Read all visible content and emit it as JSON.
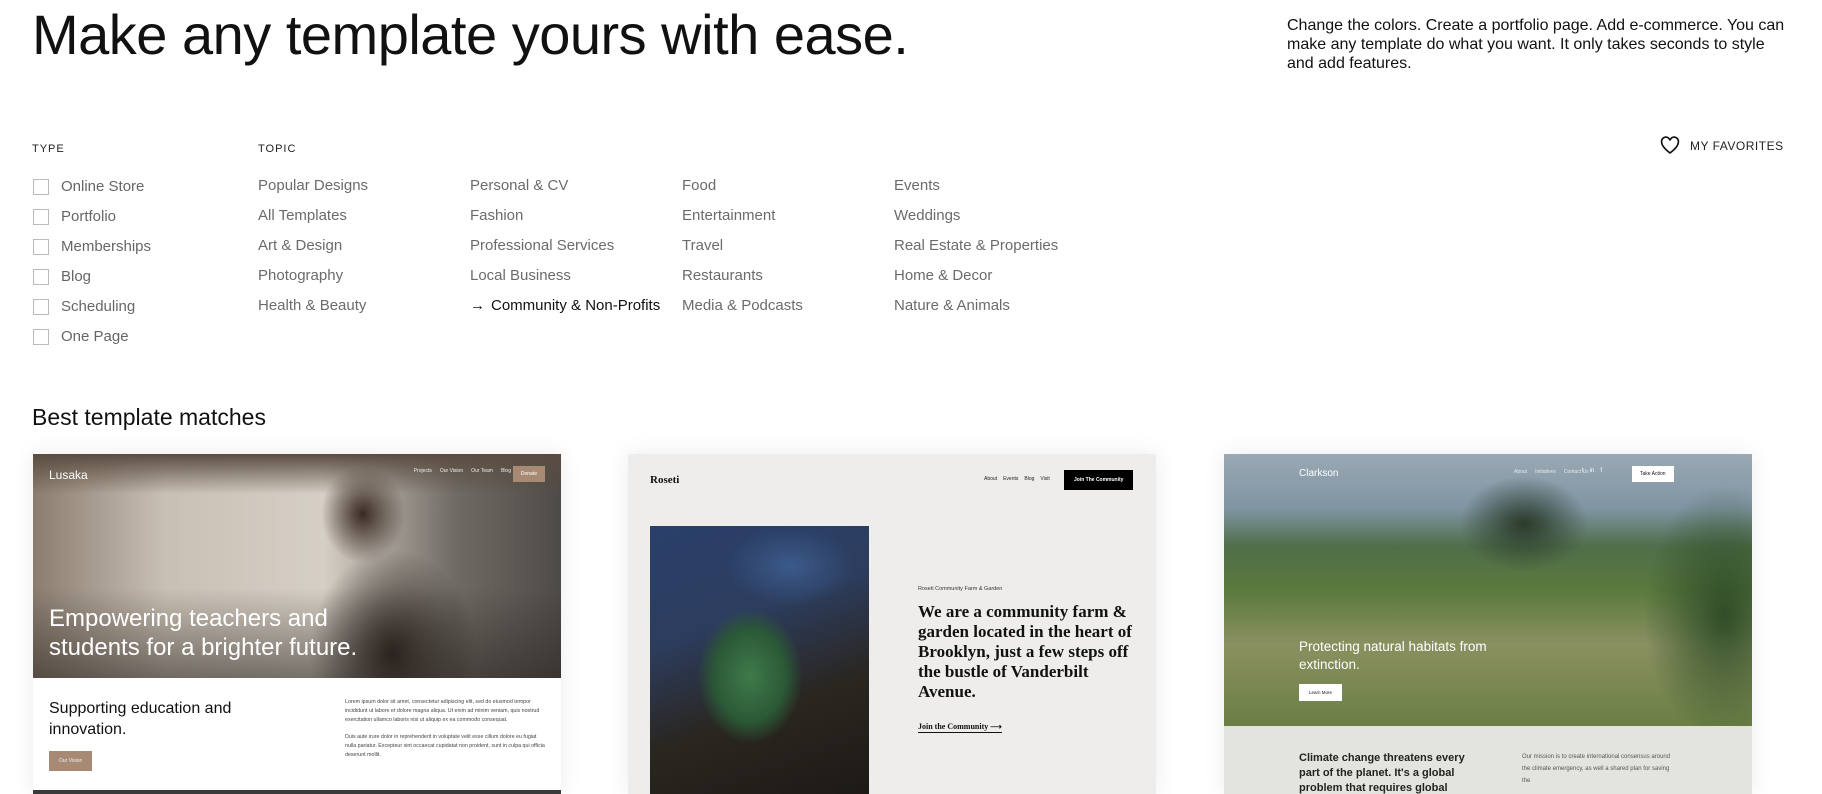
{
  "header": {
    "title": "Make any template yours with ease.",
    "intro": "Change the colors. Create a portfolio page. Add e-commerce. You can make any template do what you want. It only takes seconds to style and add features.",
    "favorites_label": "MY FAVORITES",
    "favorites_icon": "heart-icon"
  },
  "filters": {
    "type_label": "TYPE",
    "types": [
      "Online Store",
      "Portfolio",
      "Memberships",
      "Blog",
      "Scheduling",
      "One Page"
    ],
    "topic_label": "TOPIC",
    "topic_columns": [
      [
        "Popular Designs",
        "All Templates",
        "Art & Design",
        "Photography",
        "Health & Beauty"
      ],
      [
        "Personal & CV",
        "Fashion",
        "Professional Services",
        "Local Business",
        "Community & Non-Profits"
      ],
      [
        "Food",
        "Entertainment",
        "Travel",
        "Restaurants",
        "Media & Podcasts"
      ],
      [
        "Events",
        "Weddings",
        "Real Estate & Properties",
        "Home & Decor",
        "Nature & Animals"
      ]
    ],
    "active_topic": "Community & Non-Profits",
    "active_marker": "→"
  },
  "results": {
    "title": "Best template matches",
    "templates": [
      {
        "name": "Lusaka",
        "nav": [
          "Projects",
          "Our Vision",
          "Our Team",
          "Blog"
        ],
        "cta": "Donate",
        "hero": "Empowering teachers and students for a brighter future.",
        "subhead": "Supporting education and innovation.",
        "button": "Our Vision",
        "body": [
          "Lorem ipsum dolor sit amet, consectetur adipiscing elit, sed do eiusmod tempor incididunt ut labore et dolore magna aliqua. Ut enim ad minim veniam, quis nostrud exercitation ullamco laboris nisi ut aliquip ex ea commodo consequat.",
          "Duis aute irure dolor in reprehenderit in voluptate velit esse cillum dolore eu fugiat nulla pariatur. Excepteur sint occaecat cupidatat non proident, sunt in culpa qui officia deserunt mollit."
        ],
        "accent": "#a88a74"
      },
      {
        "name": "Roseti",
        "nav": [
          "About",
          "Events",
          "Blog",
          "Visit"
        ],
        "cta": "Join The Community",
        "caption": "Roseti Community Farm & Garden",
        "hero": "We are a community farm & garden located in the heart of Brooklyn, just a few steps off the bustle of Vanderbilt Avenue.",
        "link": "Join the Community ⟶"
      },
      {
        "name": "Clarkson",
        "nav": [
          "About",
          "Initiatives",
          "Contact Us"
        ],
        "social": [
          "twitter-icon",
          "linkedin-icon",
          "facebook-icon"
        ],
        "cta": "Take Action",
        "hero": "Protecting natural habitats from extinction.",
        "button": "Learn More",
        "subhead": "Climate change threatens every part of the planet. It's a global problem that requires global",
        "body": "Our mission is to create international consensus around the climate emergency, as well a shared plan for saving the"
      }
    ]
  }
}
